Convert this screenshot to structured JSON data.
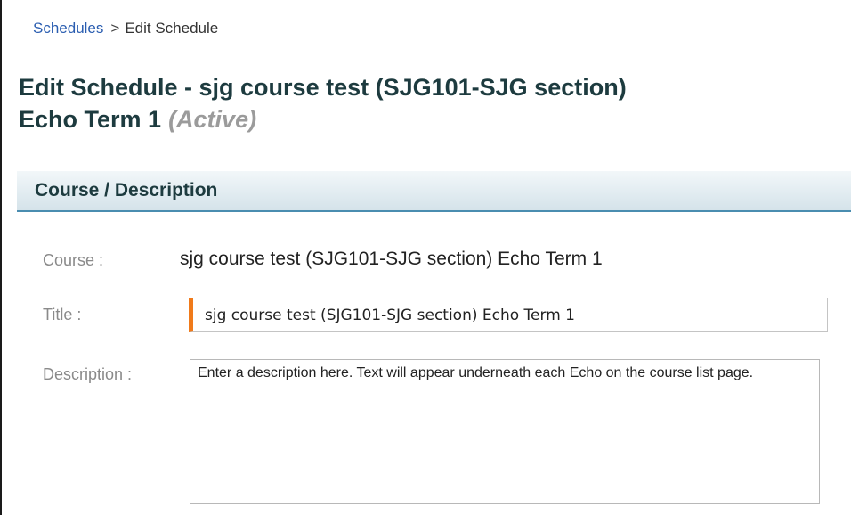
{
  "breadcrumb": {
    "parent_label": "Schedules",
    "separator": ">",
    "current_label": "Edit Schedule"
  },
  "page": {
    "title_line1": "Edit Schedule - sjg course test (SJG101-SJG section)",
    "title_line2": "Echo Term 1",
    "status": "(Active)"
  },
  "section": {
    "header": "Course / Description"
  },
  "form": {
    "course_label": "Course :",
    "course_value": "sjg course test (SJG101-SJG section) Echo Term 1",
    "title_label": "Title :",
    "title_value": "sjg course test (SJG101-SJG section) Echo Term 1",
    "description_label": "Description :",
    "description_value": "Enter a description here. Text will appear underneath each Echo on the course list page."
  },
  "colors": {
    "link": "#2a5db0",
    "heading": "#1d3b3f",
    "status": "#9b9b9b",
    "required_marker": "#f07a1a",
    "section_rule": "#4a8db0"
  }
}
